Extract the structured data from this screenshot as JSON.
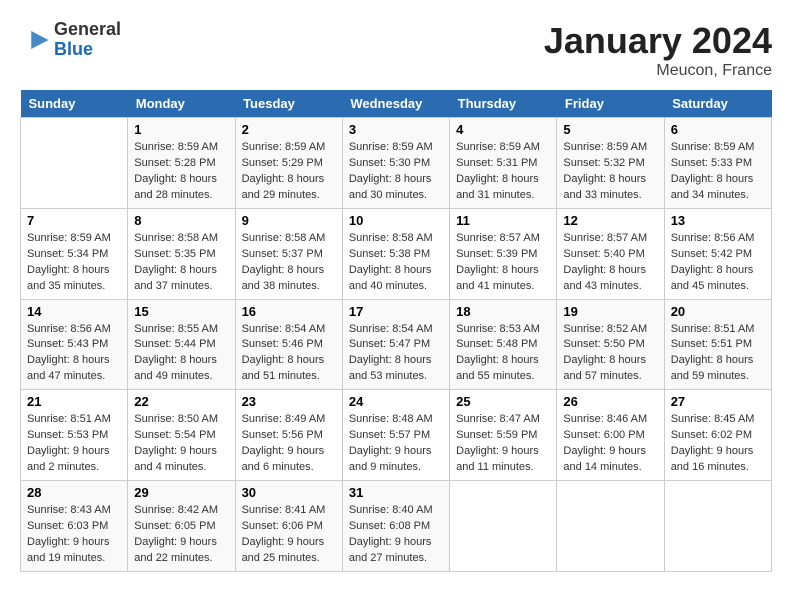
{
  "header": {
    "logo_line1": "General",
    "logo_line2": "Blue",
    "month": "January 2024",
    "location": "Meucon, France"
  },
  "days_of_week": [
    "Sunday",
    "Monday",
    "Tuesday",
    "Wednesday",
    "Thursday",
    "Friday",
    "Saturday"
  ],
  "weeks": [
    [
      {
        "num": "",
        "info": ""
      },
      {
        "num": "1",
        "info": "Sunrise: 8:59 AM\nSunset: 5:28 PM\nDaylight: 8 hours\nand 28 minutes."
      },
      {
        "num": "2",
        "info": "Sunrise: 8:59 AM\nSunset: 5:29 PM\nDaylight: 8 hours\nand 29 minutes."
      },
      {
        "num": "3",
        "info": "Sunrise: 8:59 AM\nSunset: 5:30 PM\nDaylight: 8 hours\nand 30 minutes."
      },
      {
        "num": "4",
        "info": "Sunrise: 8:59 AM\nSunset: 5:31 PM\nDaylight: 8 hours\nand 31 minutes."
      },
      {
        "num": "5",
        "info": "Sunrise: 8:59 AM\nSunset: 5:32 PM\nDaylight: 8 hours\nand 33 minutes."
      },
      {
        "num": "6",
        "info": "Sunrise: 8:59 AM\nSunset: 5:33 PM\nDaylight: 8 hours\nand 34 minutes."
      }
    ],
    [
      {
        "num": "7",
        "info": "Sunrise: 8:59 AM\nSunset: 5:34 PM\nDaylight: 8 hours\nand 35 minutes."
      },
      {
        "num": "8",
        "info": "Sunrise: 8:58 AM\nSunset: 5:35 PM\nDaylight: 8 hours\nand 37 minutes."
      },
      {
        "num": "9",
        "info": "Sunrise: 8:58 AM\nSunset: 5:37 PM\nDaylight: 8 hours\nand 38 minutes."
      },
      {
        "num": "10",
        "info": "Sunrise: 8:58 AM\nSunset: 5:38 PM\nDaylight: 8 hours\nand 40 minutes."
      },
      {
        "num": "11",
        "info": "Sunrise: 8:57 AM\nSunset: 5:39 PM\nDaylight: 8 hours\nand 41 minutes."
      },
      {
        "num": "12",
        "info": "Sunrise: 8:57 AM\nSunset: 5:40 PM\nDaylight: 8 hours\nand 43 minutes."
      },
      {
        "num": "13",
        "info": "Sunrise: 8:56 AM\nSunset: 5:42 PM\nDaylight: 8 hours\nand 45 minutes."
      }
    ],
    [
      {
        "num": "14",
        "info": "Sunrise: 8:56 AM\nSunset: 5:43 PM\nDaylight: 8 hours\nand 47 minutes."
      },
      {
        "num": "15",
        "info": "Sunrise: 8:55 AM\nSunset: 5:44 PM\nDaylight: 8 hours\nand 49 minutes."
      },
      {
        "num": "16",
        "info": "Sunrise: 8:54 AM\nSunset: 5:46 PM\nDaylight: 8 hours\nand 51 minutes."
      },
      {
        "num": "17",
        "info": "Sunrise: 8:54 AM\nSunset: 5:47 PM\nDaylight: 8 hours\nand 53 minutes."
      },
      {
        "num": "18",
        "info": "Sunrise: 8:53 AM\nSunset: 5:48 PM\nDaylight: 8 hours\nand 55 minutes."
      },
      {
        "num": "19",
        "info": "Sunrise: 8:52 AM\nSunset: 5:50 PM\nDaylight: 8 hours\nand 57 minutes."
      },
      {
        "num": "20",
        "info": "Sunrise: 8:51 AM\nSunset: 5:51 PM\nDaylight: 8 hours\nand 59 minutes."
      }
    ],
    [
      {
        "num": "21",
        "info": "Sunrise: 8:51 AM\nSunset: 5:53 PM\nDaylight: 9 hours\nand 2 minutes."
      },
      {
        "num": "22",
        "info": "Sunrise: 8:50 AM\nSunset: 5:54 PM\nDaylight: 9 hours\nand 4 minutes."
      },
      {
        "num": "23",
        "info": "Sunrise: 8:49 AM\nSunset: 5:56 PM\nDaylight: 9 hours\nand 6 minutes."
      },
      {
        "num": "24",
        "info": "Sunrise: 8:48 AM\nSunset: 5:57 PM\nDaylight: 9 hours\nand 9 minutes."
      },
      {
        "num": "25",
        "info": "Sunrise: 8:47 AM\nSunset: 5:59 PM\nDaylight: 9 hours\nand 11 minutes."
      },
      {
        "num": "26",
        "info": "Sunrise: 8:46 AM\nSunset: 6:00 PM\nDaylight: 9 hours\nand 14 minutes."
      },
      {
        "num": "27",
        "info": "Sunrise: 8:45 AM\nSunset: 6:02 PM\nDaylight: 9 hours\nand 16 minutes."
      }
    ],
    [
      {
        "num": "28",
        "info": "Sunrise: 8:43 AM\nSunset: 6:03 PM\nDaylight: 9 hours\nand 19 minutes."
      },
      {
        "num": "29",
        "info": "Sunrise: 8:42 AM\nSunset: 6:05 PM\nDaylight: 9 hours\nand 22 minutes."
      },
      {
        "num": "30",
        "info": "Sunrise: 8:41 AM\nSunset: 6:06 PM\nDaylight: 9 hours\nand 25 minutes."
      },
      {
        "num": "31",
        "info": "Sunrise: 8:40 AM\nSunset: 6:08 PM\nDaylight: 9 hours\nand 27 minutes."
      },
      {
        "num": "",
        "info": ""
      },
      {
        "num": "",
        "info": ""
      },
      {
        "num": "",
        "info": ""
      }
    ]
  ]
}
